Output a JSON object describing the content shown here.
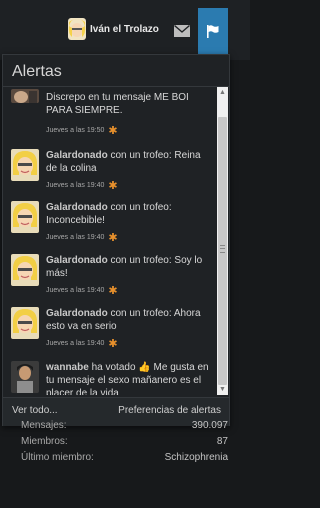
{
  "header": {
    "username": "Iván el Trolazo",
    "icons": [
      "mail-icon",
      "flag-icon"
    ],
    "accent": "#2b7bb0"
  },
  "alerts": {
    "title": "Alertas",
    "items": [
      {
        "user": "",
        "text": "Discrepo en tu mensaje ME BOI PARA SIEMPRE.",
        "time": "Jueves a las 19:50"
      },
      {
        "user": "Galardonado",
        "action": "con un trofeo:",
        "detail": "Reina de la colina",
        "time": "Jueves a las 19:40"
      },
      {
        "user": "Galardonado",
        "action": "con un trofeo:",
        "detail": "Inconcebible!",
        "time": "Jueves a las 19:40"
      },
      {
        "user": "Galardonado",
        "action": "con un trofeo:",
        "detail": "Soy lo más!",
        "time": "Jueves a las 19:40"
      },
      {
        "user": "Galardonado",
        "action": "con un trofeo:",
        "detail": "Ahora esto va en serio",
        "time": "Jueves a las 19:40"
      },
      {
        "user": "wannabe",
        "action": "ha votado",
        "detail": "Me gusta en tu mensaje el sexo mañanero es el placer de la vida"
      }
    ],
    "footer_left": "Ver todo...",
    "footer_right": "Preferencias de alertas",
    "star_color": "#e8912c"
  },
  "stats": {
    "rows": [
      {
        "label": "Mensajes:",
        "value": "390.097"
      },
      {
        "label": "Miembros:",
        "value": "87"
      },
      {
        "label": "Último miembro:",
        "value": "Schizophrenia"
      }
    ]
  }
}
